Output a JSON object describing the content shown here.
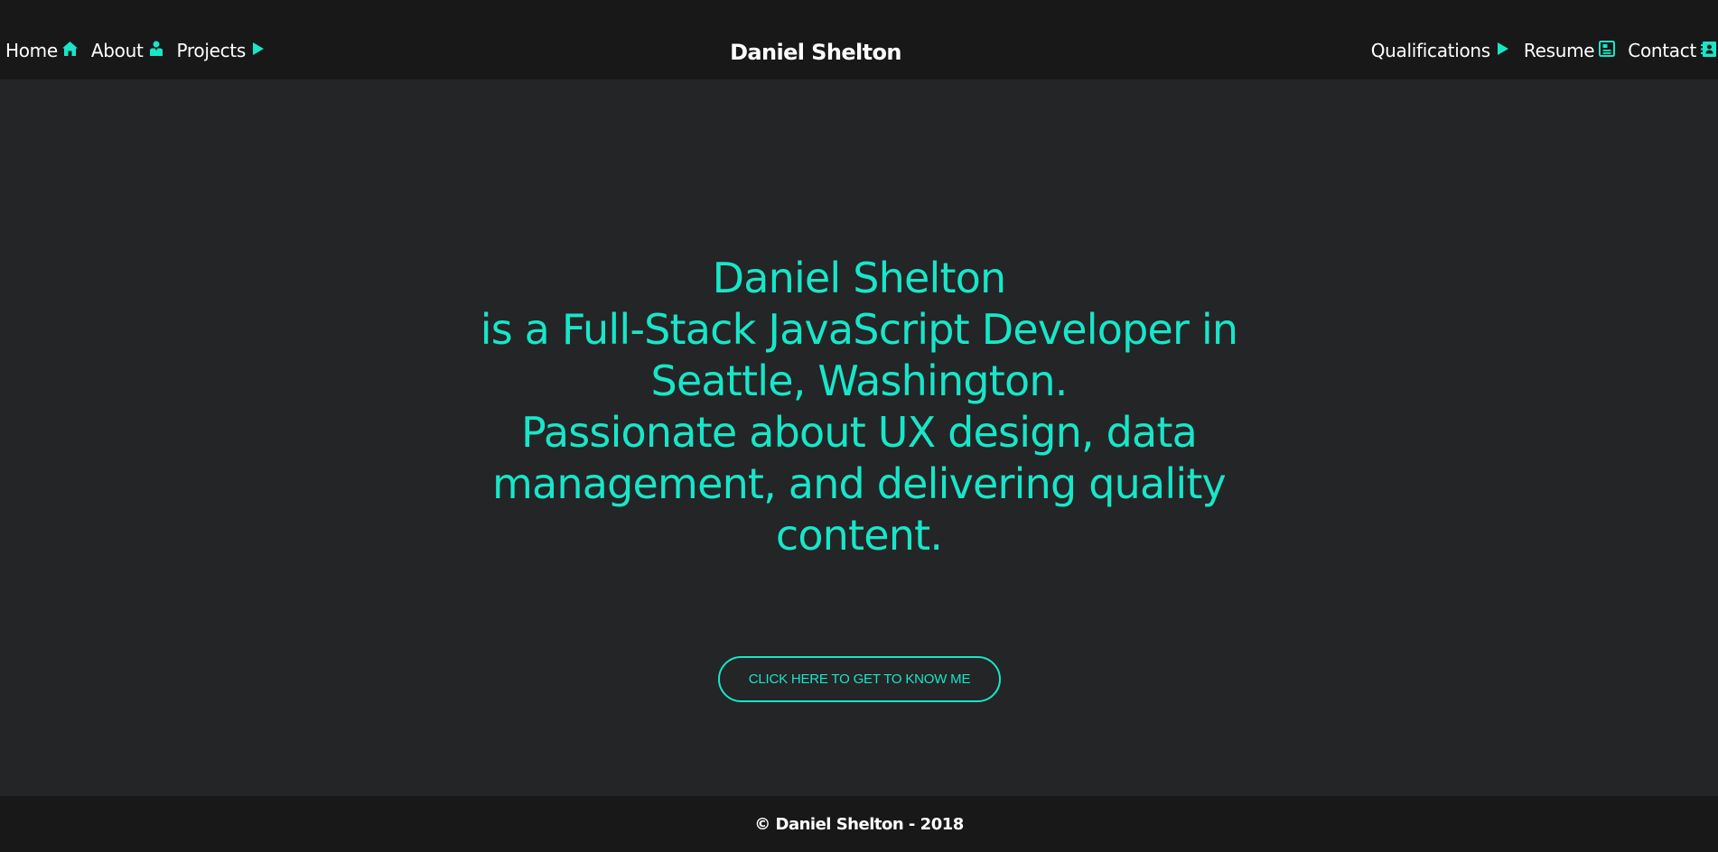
{
  "nav": {
    "brand": "Daniel Shelton",
    "left_items": [
      {
        "label": "Home",
        "icon": "home-icon"
      },
      {
        "label": "About",
        "icon": "user-icon"
      },
      {
        "label": "Projects",
        "icon": "play-icon"
      }
    ],
    "right_items": [
      {
        "label": "Qualifications",
        "icon": "play-icon"
      },
      {
        "label": "Resume",
        "icon": "document-icon"
      },
      {
        "label": "Contact",
        "icon": "contact-card-icon"
      }
    ]
  },
  "hero": {
    "lines": [
      "Daniel Shelton",
      "is a Full-Stack JavaScript Developer in",
      "Seattle, Washington.",
      "Passionate about UX design, data",
      "management, and delivering quality",
      "content."
    ],
    "cta_label": "CLICK HERE TO GET TO KNOW ME"
  },
  "footer": {
    "text": "© Daniel Shelton - 2018"
  },
  "colors": {
    "accent": "#18e6c8",
    "navbar_bg": "#181818",
    "page_bg": "#242527",
    "text": "#ffffff"
  }
}
